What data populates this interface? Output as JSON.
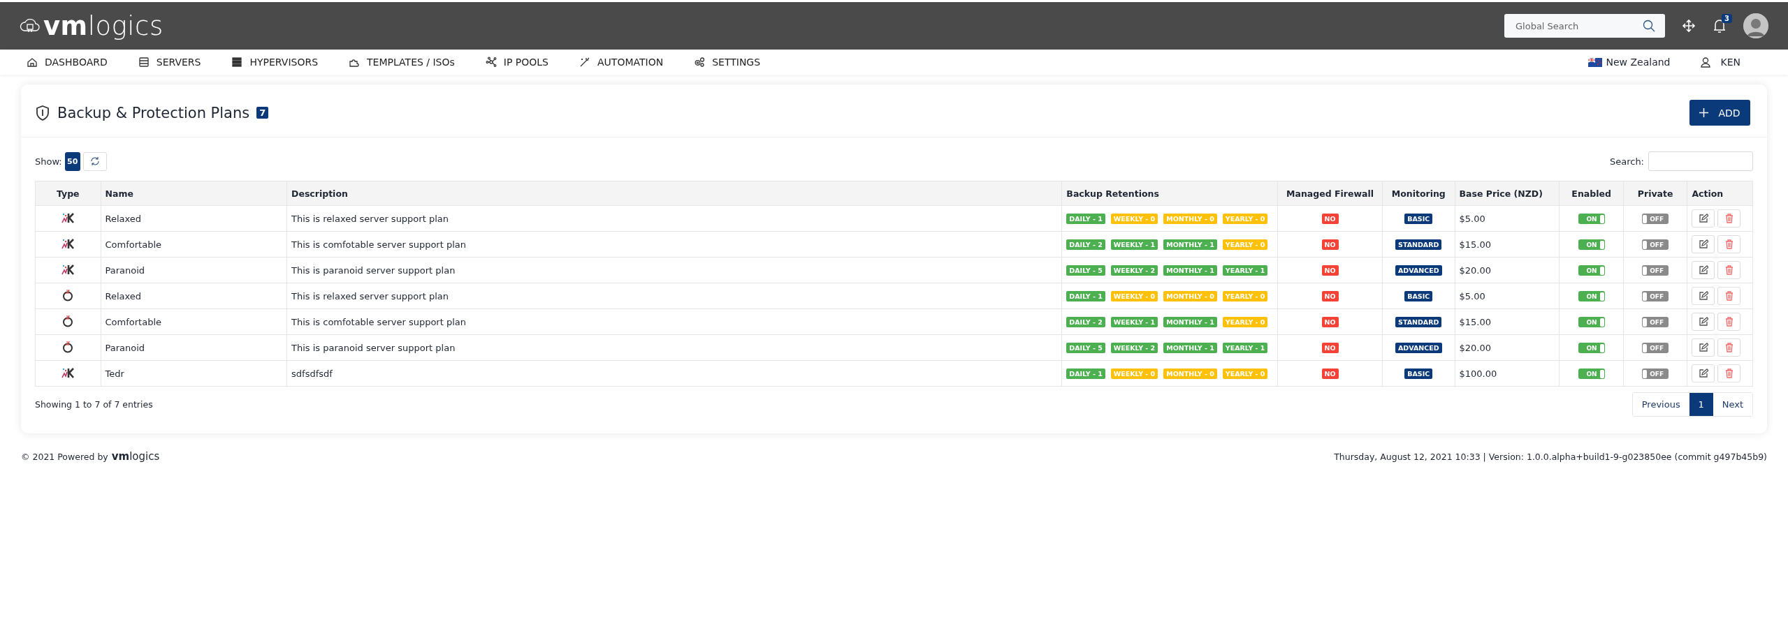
{
  "topbar": {
    "logo": "**vm**logics",
    "search": {
      "placeholder": "Global Search"
    },
    "notifications": "3"
  },
  "nav": {
    "items": [
      {
        "label": "DASHBOARD"
      },
      {
        "label": "SERVERS"
      },
      {
        "label": "HYPERVISORS"
      },
      {
        "label": "TEMPLATES / ISOs"
      },
      {
        "label": "IP POOLS"
      },
      {
        "label": "AUTOMATION"
      },
      {
        "label": "SETTINGS"
      }
    ],
    "region": "New Zealand",
    "user": "KEN"
  },
  "card": {
    "title": "Backup & Protection Plans",
    "count": "7",
    "add_button": "ADD",
    "show_label": "Show:",
    "page_size": "50",
    "search_label": "Search:",
    "table": {
      "columns": [
        "Type",
        "Name",
        "Description",
        "Backup Retentions",
        "Managed Firewall",
        "Monitoring",
        "Base Price (NZD)",
        "Enabled",
        "Private",
        "Action"
      ],
      "rows": [
        {
          "kind": "k",
          "name": "Relaxed",
          "description": "This is relaxed server support plan",
          "retentions": [
            {
              "label": "DAILY - 1",
              "color": "#4caf50"
            },
            {
              "label": "WEEKLY - 0",
              "color": "#ffc107"
            },
            {
              "label": "MONTHLY - 0",
              "color": "#ffc107"
            },
            {
              "label": "YEARLY - 0",
              "color": "#ffc107"
            }
          ],
          "firewall": {
            "label": "NO",
            "on": false
          },
          "monitoring": "BASIC",
          "price": "$5.00",
          "enabled": {
            "label": "ON",
            "on": true
          },
          "private": {
            "label": "OFF",
            "on": false
          }
        },
        {
          "kind": "k",
          "name": "Comfortable",
          "description": "This is comfotable server support plan",
          "retentions": [
            {
              "label": "DAILY - 2",
              "color": "#4caf50"
            },
            {
              "label": "WEEKLY - 1",
              "color": "#4caf50"
            },
            {
              "label": "MONTHLY - 1",
              "color": "#4caf50"
            },
            {
              "label": "YEARLY - 0",
              "color": "#ffc107"
            }
          ],
          "firewall": {
            "label": "NO",
            "on": false
          },
          "monitoring": "STANDARD",
          "price": "$15.00",
          "enabled": {
            "label": "ON",
            "on": true
          },
          "private": {
            "label": "OFF",
            "on": false
          }
        },
        {
          "kind": "k",
          "name": "Paranoid",
          "description": "This is paranoid server support plan",
          "retentions": [
            {
              "label": "DAILY - 5",
              "color": "#4caf50"
            },
            {
              "label": "WEEKLY - 2",
              "color": "#4caf50"
            },
            {
              "label": "MONTHLY - 1",
              "color": "#4caf50"
            },
            {
              "label": "YEARLY - 1",
              "color": "#4caf50"
            }
          ],
          "firewall": {
            "label": "NO",
            "on": false
          },
          "monitoring": "ADVANCED",
          "price": "$20.00",
          "enabled": {
            "label": "ON",
            "on": true
          },
          "private": {
            "label": "OFF",
            "on": false
          }
        },
        {
          "kind": "ring",
          "name": "Relaxed",
          "description": "This is relaxed server support plan",
          "retentions": [
            {
              "label": "DAILY - 1",
              "color": "#4caf50"
            },
            {
              "label": "WEEKLY - 0",
              "color": "#ffc107"
            },
            {
              "label": "MONTHLY - 0",
              "color": "#ffc107"
            },
            {
              "label": "YEARLY - 0",
              "color": "#ffc107"
            }
          ],
          "firewall": {
            "label": "NO",
            "on": false
          },
          "monitoring": "BASIC",
          "price": "$5.00",
          "enabled": {
            "label": "ON",
            "on": true
          },
          "private": {
            "label": "OFF",
            "on": false
          }
        },
        {
          "kind": "ring",
          "name": "Comfortable",
          "description": "This is comfotable server support plan",
          "retentions": [
            {
              "label": "DAILY - 2",
              "color": "#4caf50"
            },
            {
              "label": "WEEKLY - 1",
              "color": "#4caf50"
            },
            {
              "label": "MONTHLY - 1",
              "color": "#4caf50"
            },
            {
              "label": "YEARLY - 0",
              "color": "#ffc107"
            }
          ],
          "firewall": {
            "label": "NO",
            "on": false
          },
          "monitoring": "STANDARD",
          "price": "$15.00",
          "enabled": {
            "label": "ON",
            "on": true
          },
          "private": {
            "label": "OFF",
            "on": false
          }
        },
        {
          "kind": "ring",
          "name": "Paranoid",
          "description": "This is paranoid server support plan",
          "retentions": [
            {
              "label": "DAILY - 5",
              "color": "#4caf50"
            },
            {
              "label": "WEEKLY - 2",
              "color": "#4caf50"
            },
            {
              "label": "MONTHLY - 1",
              "color": "#4caf50"
            },
            {
              "label": "YEARLY - 1",
              "color": "#4caf50"
            }
          ],
          "firewall": {
            "label": "NO",
            "on": false
          },
          "monitoring": "ADVANCED",
          "price": "$20.00",
          "enabled": {
            "label": "ON",
            "on": true
          },
          "private": {
            "label": "OFF",
            "on": false
          }
        },
        {
          "kind": "k",
          "name": "Tedr",
          "description": "sdfsdfsdf",
          "retentions": [
            {
              "label": "DAILY - 1",
              "color": "#4caf50"
            },
            {
              "label": "WEEKLY - 0",
              "color": "#ffc107"
            },
            {
              "label": "MONTHLY - 0",
              "color": "#ffc107"
            },
            {
              "label": "YEARLY - 0",
              "color": "#ffc107"
            }
          ],
          "firewall": {
            "label": "NO",
            "on": false
          },
          "monitoring": "BASIC",
          "price": "$100.00",
          "enabled": {
            "label": "ON",
            "on": true
          },
          "private": {
            "label": "OFF",
            "on": false
          }
        }
      ]
    },
    "info": "Showing 1 to 7 of 7 entries",
    "pagination": {
      "previous": "Previous",
      "pages": [
        {
          "label": "1",
          "selected": true
        }
      ],
      "next": "Next"
    }
  },
  "footer": {
    "copyright": "© 2021 Powered by",
    "brand": "**vm**logics",
    "version": "Thursday, August 12, 2021 10:33 | Version: 1.0.0.alpha+build1-9-g023850ee (commit g497b45b9)"
  }
}
